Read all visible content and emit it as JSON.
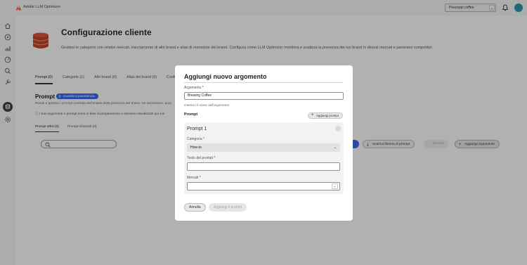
{
  "app": {
    "title": "Adobe LLM Optimizer",
    "org": "Pesceppi.coffee"
  },
  "page": {
    "title": "Configurazione cliente",
    "description": "Gestisci le categorie con relativi mercati, tracciamento di altri brand e alias di menzione del brand. Configura come LLM Optimizer monitora e analizza la presenza dei tuo brand in diversi mercati e panorami competitivi."
  },
  "tabs": [
    {
      "label": "Prompt (0)"
    },
    {
      "label": "Categorie (1)"
    },
    {
      "label": "Altri brand (0)"
    },
    {
      "label": "Alias del brand (0)"
    },
    {
      "label": "Configura"
    }
  ],
  "section": {
    "title": "Prompt",
    "guide_label": "Guarda la panoramica",
    "description": "Rivedi e gestisci i prompt correlati dell'analisi della presenza del brand. Se necessario, puoi",
    "info": "I tuoi argomenti e prompt sono in fase di preparazione e saranno visualizzati qui a b"
  },
  "subtabs": [
    {
      "label": "Prompt attivi (0)"
    },
    {
      "label": "Prompt eliminati (0)"
    }
  ],
  "actions": {
    "download": "Scarica libreria di prompt",
    "disabled": "Elimina",
    "add": "Aggiungi argomento"
  },
  "modal": {
    "title": "Aggiungi nuovo argomento",
    "topic_label": "Argomento",
    "required_mark": "*",
    "topic_value": "Brewing Coffee",
    "topic_help": "Inserisci il nome dell'argomento",
    "prompt_heading": "Prompt",
    "add_prompt": "Aggiungi prompt",
    "card": {
      "title": "Prompt 1",
      "category_label": "Categoria",
      "category_value": "How-to",
      "text_label": "Testo del prompt",
      "text_value": "",
      "markets_label": "Mercati",
      "markets_value": ""
    },
    "cancel": "Annulla",
    "submit": "Aggiungi il prompt"
  }
}
